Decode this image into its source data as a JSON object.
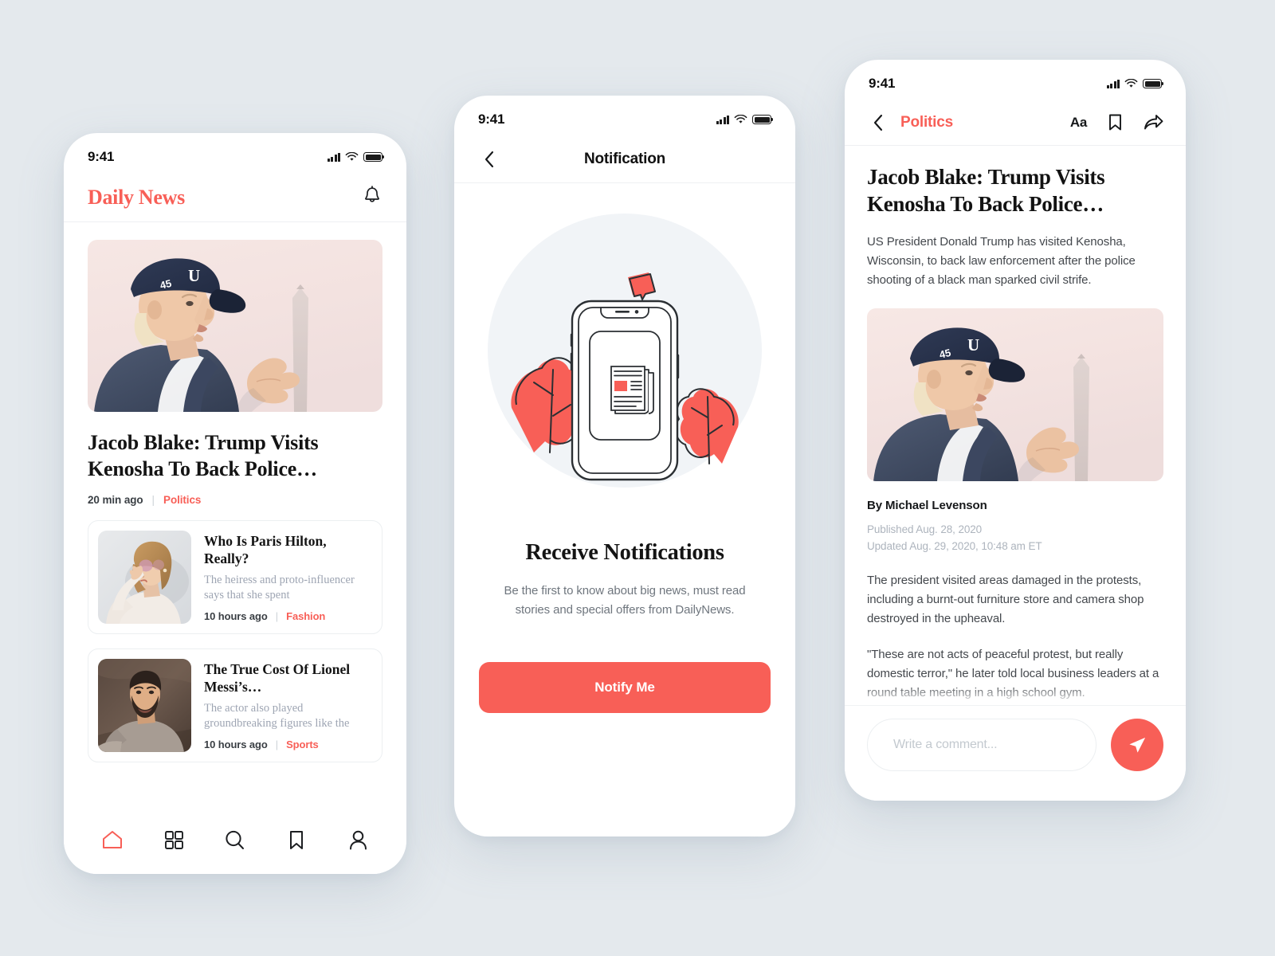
{
  "theme": {
    "accent": "#f85f57",
    "page_background": "#e4e9ed",
    "text_dark": "#141414",
    "text_muted": "#9ea5b3"
  },
  "status_bar": {
    "time": "9:41",
    "icons": [
      "signal-icon",
      "wifi-icon",
      "battery-icon"
    ]
  },
  "home_screen": {
    "brand": "Daily News",
    "bell_icon": "bell-icon",
    "hero": {
      "image_alt": "Donald Trump in navy 45 cap speaking, Washington Monument behind",
      "title": "Jacob Blake: Trump Visits Kenosha To Back Police…",
      "time": "20 min ago",
      "separator": "|",
      "category": "Politics"
    },
    "cards": [
      {
        "image_alt": "Woman with blonde bob adjusting pink sunglasses",
        "title": "Who Is Paris Hilton, Really?",
        "description": "The heiress and proto-influencer says that she spent",
        "time": "10 hours ago",
        "separator": "|",
        "category": "Fashion"
      },
      {
        "image_alt": "Bearded man in grey sweatshirt against dark backdrop",
        "title": "The True Cost Of Lionel Messi’s…",
        "description": "The actor also played groundbreaking figures like the",
        "time": "10 hours ago",
        "separator": "|",
        "category": "Sports"
      }
    ],
    "tabbar": [
      {
        "name": "home",
        "icon": "home-icon",
        "active": true
      },
      {
        "name": "categories",
        "icon": "grid-icon",
        "active": false
      },
      {
        "name": "search",
        "icon": "search-icon",
        "active": false
      },
      {
        "name": "bookmarks",
        "icon": "bookmark-icon",
        "active": false
      },
      {
        "name": "profile",
        "icon": "person-icon",
        "active": false
      }
    ]
  },
  "notification_screen": {
    "back_icon": "chevron-left-icon",
    "title": "Notification",
    "illustration_alt": "Phone with news article on screen, notification badge and red foliage",
    "heading": "Receive Notifications",
    "subtitle": "Be the first to know  about big news, must read stories and special offers from DailyNews.",
    "button_label": "Notify Me"
  },
  "article_screen": {
    "back_icon": "chevron-left-icon",
    "category": "Politics",
    "text_size_label": "Aa",
    "bookmark_icon": "bookmark-icon",
    "share_icon": "share-icon",
    "title": "Jacob Blake: Trump Visits Kenosha To Back Police…",
    "lede": "US President Donald Trump has visited Kenosha, Wisconsin, to back law enforcement after the police shooting of a black man sparked civil strife.",
    "image_alt": "Donald Trump in navy 45 cap speaking, Washington Monument behind",
    "author": "By Michael Levenson",
    "published": "Published Aug. 28, 2020",
    "updated": "Updated Aug. 29, 2020, 10:48 am ET",
    "paragraphs": [
      "The president visited areas damaged in the protests, including a burnt-out furniture store and camera shop destroyed in the upheaval.",
      "\"These are not acts of peaceful protest, but really domestic terror,\" he later told local business leaders at a round table meeting in a high school gym."
    ],
    "comment_placeholder": "Write a comment...",
    "send_icon": "send-icon"
  }
}
